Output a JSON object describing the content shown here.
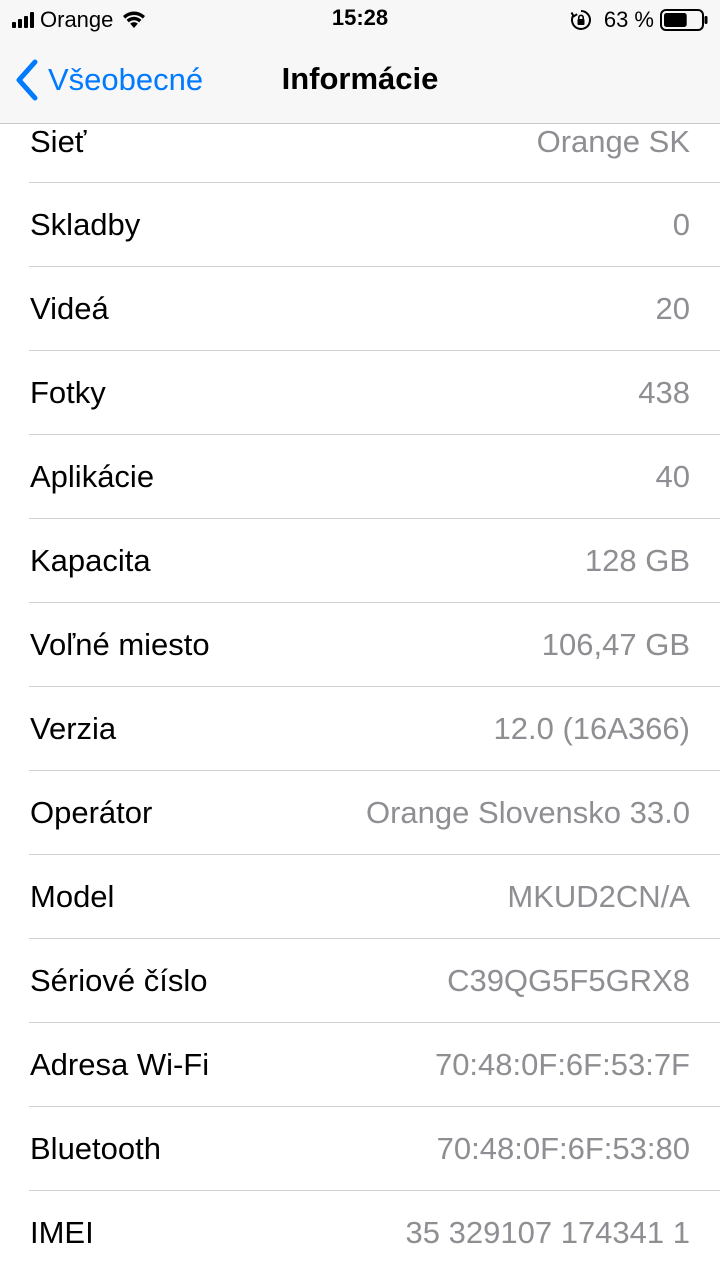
{
  "status_bar": {
    "carrier": "Orange",
    "time": "15:28",
    "battery_percent": "63 %",
    "battery_level": 0.63,
    "icons": [
      "signal-icon",
      "wifi-icon",
      "rotation-lock-icon",
      "battery-icon"
    ]
  },
  "nav": {
    "back_label": "Všeobecné",
    "title": "Informácie",
    "accent_color": "#007aff"
  },
  "rows": [
    {
      "label": "Sieť",
      "value": "Orange SK"
    },
    {
      "label": "Skladby",
      "value": "0"
    },
    {
      "label": "Videá",
      "value": "20"
    },
    {
      "label": "Fotky",
      "value": "438"
    },
    {
      "label": "Aplikácie",
      "value": "40"
    },
    {
      "label": "Kapacita",
      "value": "128 GB"
    },
    {
      "label": "Voľné miesto",
      "value": "106,47 GB"
    },
    {
      "label": "Verzia",
      "value": "12.0 (16A366)"
    },
    {
      "label": "Operátor",
      "value": "Orange Slovensko 33.0"
    },
    {
      "label": "Model",
      "value": "MKUD2CN/A"
    },
    {
      "label": "Sériové číslo",
      "value": "C39QG5F5GRX8"
    },
    {
      "label": "Adresa Wi-Fi",
      "value": "70:48:0F:6F:53:7F"
    },
    {
      "label": "Bluetooth",
      "value": "70:48:0F:6F:53:80"
    },
    {
      "label": "IMEI",
      "value": "35 329107 174341 1"
    }
  ]
}
